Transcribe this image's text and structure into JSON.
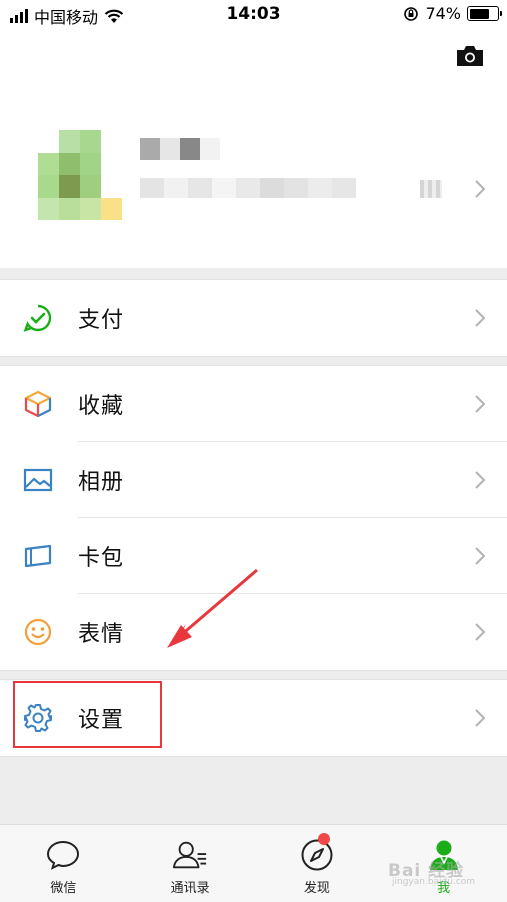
{
  "status_bar": {
    "carrier": "中国移动",
    "time": "14:03",
    "battery": "74%",
    "battery_level": 0.74
  },
  "profile": {
    "camera_icon": "camera-icon",
    "chevron_icon": "chevron-right-icon"
  },
  "menu": {
    "pay": {
      "label": "支付",
      "icon": "pay-check-icon",
      "color": "#1aad19"
    },
    "favorites": {
      "label": "收藏",
      "icon": "cube-icon"
    },
    "album": {
      "label": "相册",
      "icon": "image-icon",
      "color": "#3b82c4"
    },
    "cards": {
      "label": "卡包",
      "icon": "card-icon",
      "color": "#3b82c4"
    },
    "stickers": {
      "label": "表情",
      "icon": "smiley-icon",
      "color": "#f0a03a"
    },
    "settings": {
      "label": "设置",
      "icon": "gear-icon",
      "color": "#3b82c4"
    }
  },
  "tabs": [
    {
      "label": "微信",
      "icon": "chat-bubble-icon"
    },
    {
      "label": "通讯录",
      "icon": "contacts-icon"
    },
    {
      "label": "发现",
      "icon": "compass-icon"
    },
    {
      "label": "我",
      "icon": "person-icon"
    }
  ],
  "colors": {
    "accent": "#1aad19",
    "highlight": "#e8383d",
    "badge": "#f04848"
  },
  "watermark": {
    "text": "Bai 经验",
    "sub": "jingyan.baidu.com"
  }
}
